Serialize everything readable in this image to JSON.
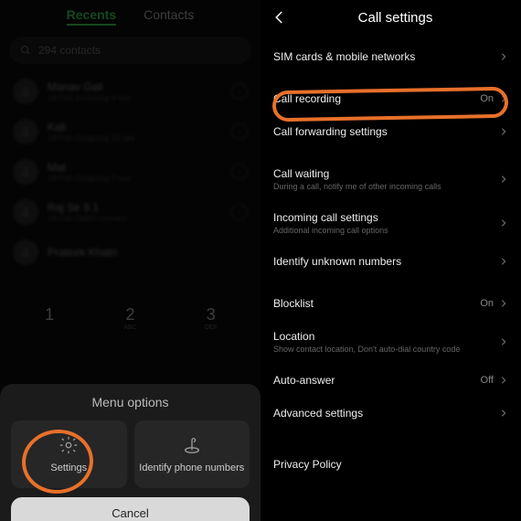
{
  "left": {
    "tabs": {
      "recents": "Recents",
      "contacts": "Contacts"
    },
    "search_placeholder": "294 contacts",
    "calls": [
      {
        "name": "Manav Gali",
        "sub": "18 Feb Incoming 4 sec"
      },
      {
        "name": "Kali",
        "sub": "18 Feb Outgoing 13 sec"
      },
      {
        "name": "Mat",
        "sub": "18 Feb Outgoing 7 sec"
      },
      {
        "name": "Raj Sir 9.1",
        "sub": "18 Feb Didn't connect"
      },
      {
        "name": "Prateek Khatri",
        "sub": ""
      }
    ],
    "dial": [
      {
        "n": "1",
        "s": ""
      },
      {
        "n": "2",
        "s": "ABC"
      },
      {
        "n": "3",
        "s": "DEF"
      }
    ],
    "sheet": {
      "title": "Menu options",
      "settings": "Settings",
      "identify": "Identify phone numbers",
      "cancel": "Cancel"
    }
  },
  "right": {
    "title": "Call settings",
    "items": [
      {
        "label": "SIM cards & mobile networks",
        "sub": "",
        "val": ""
      },
      {
        "label": "Call recording",
        "sub": "",
        "val": "On"
      },
      {
        "label": "Call forwarding settings",
        "sub": "",
        "val": ""
      },
      {
        "label": "Call waiting",
        "sub": "During a call, notify me of other incoming calls",
        "val": ""
      },
      {
        "label": "Incoming call settings",
        "sub": "Additional incoming call options",
        "val": ""
      },
      {
        "label": "Identify unknown numbers",
        "sub": "",
        "val": ""
      },
      {
        "label": "Blocklist",
        "sub": "",
        "val": "On"
      },
      {
        "label": "Location",
        "sub": "Show contact location, Don't auto-dial country code",
        "val": ""
      },
      {
        "label": "Auto-answer",
        "sub": "",
        "val": "Off"
      },
      {
        "label": "Advanced settings",
        "sub": "",
        "val": ""
      },
      {
        "label": "Privacy Policy",
        "sub": "",
        "val": ""
      }
    ]
  }
}
